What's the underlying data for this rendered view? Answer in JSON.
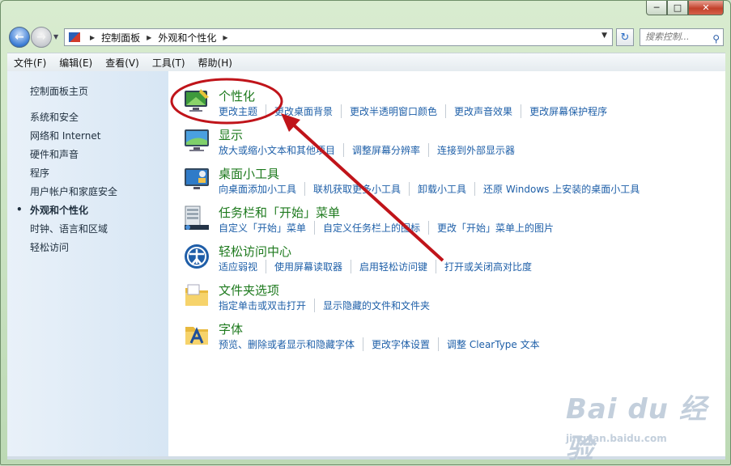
{
  "address": {
    "crumbs": [
      "控制面板",
      "外观和个性化"
    ]
  },
  "search": {
    "placeholder": "搜索控制..."
  },
  "menu": [
    "文件(F)",
    "编辑(E)",
    "查看(V)",
    "工具(T)",
    "帮助(H)"
  ],
  "sidebar": {
    "home": "控制面板主页",
    "items": [
      "系统和安全",
      "网络和 Internet",
      "硬件和声音",
      "程序",
      "用户帐户和家庭安全",
      "外观和个性化",
      "时钟、语言和区域",
      "轻松访问"
    ],
    "selected_bullet": "•"
  },
  "categories": [
    {
      "title": "个性化",
      "icon": "personalization-icon",
      "links": [
        "更改主题",
        "更改桌面背景",
        "更改半透明窗口颜色",
        "更改声音效果",
        "更改屏幕保护程序"
      ]
    },
    {
      "title": "显示",
      "icon": "display-icon",
      "links": [
        "放大或缩小文本和其他项目",
        "调整屏幕分辨率",
        "连接到外部显示器"
      ]
    },
    {
      "title": "桌面小工具",
      "icon": "gadgets-icon",
      "links": [
        "向桌面添加小工具",
        "联机获取更多小工具",
        "卸载小工具",
        "还原 Windows 上安装的桌面小工具"
      ]
    },
    {
      "title": "任务栏和「开始」菜单",
      "icon": "taskbar-icon",
      "links": [
        "自定义「开始」菜单",
        "自定义任务栏上的图标",
        "更改「开始」菜单上的图片"
      ]
    },
    {
      "title": "轻松访问中心",
      "icon": "ease-of-access-icon",
      "links": [
        "适应弱视",
        "使用屏幕读取器",
        "启用轻松访问键",
        "打开或关闭高对比度"
      ]
    },
    {
      "title": "文件夹选项",
      "icon": "folder-options-icon",
      "links": [
        "指定单击或双击打开",
        "显示隐藏的文件和文件夹"
      ]
    },
    {
      "title": "字体",
      "icon": "fonts-icon",
      "links": [
        "预览、删除或者显示和隐藏字体",
        "更改字体设置",
        "调整 ClearType 文本"
      ]
    }
  ],
  "watermark": {
    "brand": "Bai du 经验",
    "url": "jingyan.baidu.com"
  },
  "colors": {
    "title_green": "#1e7a1e",
    "link_blue": "#1e5fa8",
    "annotation_red": "#c0141a",
    "sidebar_bg": "#e3eef8"
  }
}
